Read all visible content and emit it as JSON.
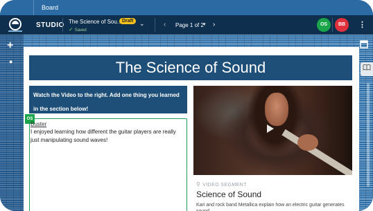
{
  "breadcrumb": {
    "label": "Board"
  },
  "header": {
    "studio_label": "STUDIO",
    "doc_title": "The Science of Sou...",
    "draft_badge": "Draft",
    "saved_status": "Saved",
    "page_indicator": "Page 1 of 2",
    "avatars": [
      {
        "initials": "OS",
        "color": "#1aa54a"
      },
      {
        "initials": "BB",
        "color": "#e0313c"
      }
    ]
  },
  "page": {
    "title": "The Science of Sound",
    "instructions": "Watch the Video to the right. Add one thing you learned in the section below!",
    "response": {
      "author_tag": "OS",
      "author": "Buster",
      "text": "I enjoyed learning how different the guitar players are really just manipulating sound waves!"
    },
    "video": {
      "segment_label": "VIDEO SEGMENT",
      "title": "Science of Sound",
      "description": "Kari and rock band Metallica explain how an electric guitar generates sound."
    }
  },
  "colors": {
    "header_bg": "#0e2f4d",
    "banner_bg": "#1e4f78",
    "accent_green": "#1aa54a",
    "draft_yellow": "#f4c21a"
  },
  "icons": {
    "add": "plus-icon",
    "palette": "palette-icon",
    "expand": "expand-icon",
    "book": "book-icon",
    "more": "more-vertical-icon"
  }
}
